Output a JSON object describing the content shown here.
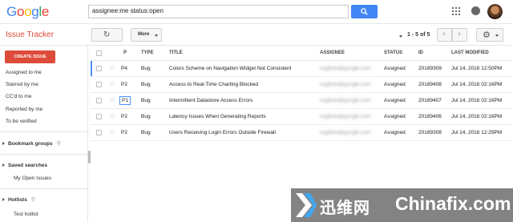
{
  "brand": {
    "letters": [
      "G",
      "o",
      "o",
      "g",
      "l",
      "e"
    ],
    "colors": [
      "#4285f4",
      "#ea4335",
      "#fbbc05",
      "#4285f4",
      "#34a853",
      "#ea4335"
    ]
  },
  "search": {
    "value": "assignee:me status:open"
  },
  "app": {
    "title": "Issue Tracker"
  },
  "toolbar": {
    "refresh_icon": "refresh-icon",
    "more_label": "More",
    "pager_text": "1 - 5 of 5",
    "prev_icon": "‹",
    "next_icon": "›",
    "settings_icon": "gear-icon"
  },
  "sidebar": {
    "create_label": "CREATE ISSUE",
    "items": [
      "Assigned to me",
      "Starred by me",
      "CC'd to me",
      "Reported by me",
      "To be verified"
    ],
    "bookmark_groups": "Bookmark groups",
    "saved_searches": "Saved searches",
    "saved_items": [
      "My Open Issues"
    ],
    "hotlists": "Hotlists",
    "hotlist_items": [
      "Test hotlist"
    ]
  },
  "table": {
    "headers": {
      "p": "P",
      "type": "TYPE",
      "title": "TITLE",
      "assignee": "ASSIGNEE",
      "status": "STATUS",
      "id": "ID",
      "modified": "LAST MODIFIED"
    },
    "rows": [
      {
        "p": "P4",
        "type": "Bug",
        "title": "Colors Scheme on Navigation Widget Not Consistent",
        "assignee": "asgthee@google.com",
        "status": "Assigned",
        "id": "20189309",
        "modified": "Jul 14, 2016 12:50PM"
      },
      {
        "p": "P2",
        "type": "Bug",
        "title": "Access to Real-Time Charting Blocked",
        "assignee": "asgthee@google.com",
        "status": "Assigned",
        "id": "20189408",
        "modified": "Jul 14, 2016 02:16PM"
      },
      {
        "p": "P1",
        "type": "Bug",
        "title": "Intermittent Datastore Access Errors",
        "assignee": "asgthee@google.com",
        "status": "Assigned",
        "id": "20189407",
        "modified": "Jul 14, 2016 02:16PM"
      },
      {
        "p": "P2",
        "type": "Bug",
        "title": "Latency Issues When Generating Reports",
        "assignee": "asgthee@google.com",
        "status": "Assigned",
        "id": "20189406",
        "modified": "Jul 14, 2016 02:16PM"
      },
      {
        "p": "P2",
        "type": "Bug",
        "title": "Users Receiving Login Errors Outside Firewall",
        "assignee": "asgthee@google.com",
        "status": "Assigned",
        "id": "20189308",
        "modified": "Jul 14, 2016 12:29PM"
      }
    ]
  },
  "watermark": {
    "cn": "迅维网",
    "en": "Chinafix.com"
  }
}
